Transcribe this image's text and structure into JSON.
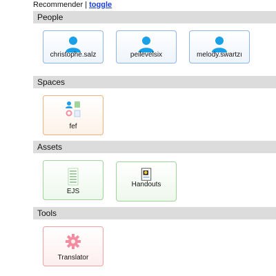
{
  "header": {
    "title": "Recommender",
    "separator": "|",
    "toggle_label": "toggle"
  },
  "sections": {
    "people": {
      "title": "People",
      "items": [
        {
          "label": "christophe.salz",
          "icon": "person-icon"
        },
        {
          "label": "peilevelsix",
          "icon": "person-icon"
        },
        {
          "label": "melody.swartzı",
          "icon": "person-icon"
        }
      ]
    },
    "spaces": {
      "title": "Spaces",
      "items": [
        {
          "label": "fef",
          "icon": "space-icon"
        }
      ]
    },
    "assets": {
      "title": "Assets",
      "items": [
        {
          "label": "EJS",
          "icon": "document-icon"
        },
        {
          "label": "Handouts",
          "icon": "handout-icon"
        }
      ]
    },
    "tools": {
      "title": "Tools",
      "items": [
        {
          "label": "Translator",
          "icon": "gear-icon"
        }
      ]
    }
  },
  "colors": {
    "section_header_bg": "#dcdcdc",
    "link": "#1a3fd6",
    "person_icon": "#1aa0e6",
    "people_border": "#8fb4e6",
    "space_border": "#f0b37a",
    "asset_border": "#9fd59a",
    "tool_border": "#f2a0a0"
  }
}
